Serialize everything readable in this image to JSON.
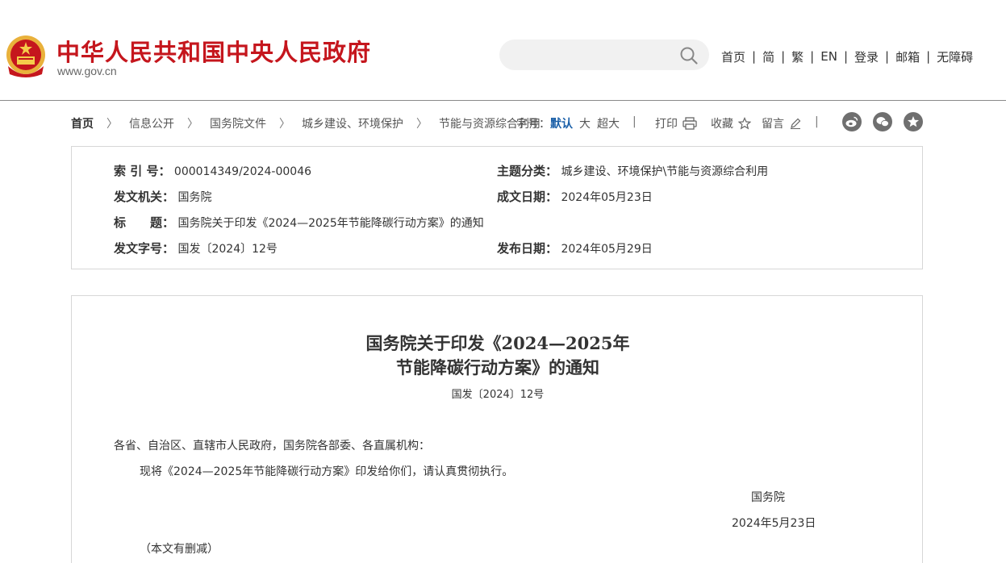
{
  "header": {
    "site_title": "中华人民共和国中央人民政府",
    "site_domain": "www.gov.cn",
    "search_placeholder": "",
    "nav": [
      "首页",
      "简",
      "繁",
      "EN",
      "登录",
      "邮箱",
      "无障碍"
    ],
    "nav_sep": "|"
  },
  "breadcrumb": {
    "home": "首页",
    "items": [
      "信息公开",
      "国务院文件",
      "城乡建设、环境保护",
      "节能与资源综合利用"
    ],
    "sep": "〉"
  },
  "toolbar": {
    "font_label": "字号：",
    "font_default": "默认",
    "font_large": "大",
    "font_xlarge": "超大",
    "print": "打印",
    "favorite": "收藏",
    "comment": "留言",
    "sep": "|"
  },
  "meta": {
    "index_label": "索 引 号：",
    "index_value": "000014349/2024-00046",
    "topic_label": "主题分类：",
    "topic_value": "城乡建设、环境保护\\节能与资源综合利用",
    "issuer_label": "发文机关：",
    "issuer_value": "国务院",
    "written_label": "成文日期：",
    "written_value": "2024年05月23日",
    "title_label": "标　　题：",
    "title_value": "国务院关于印发《2024—2025年节能降碳行动方案》的通知",
    "docno_label": "发文字号：",
    "docno_value": "国发〔2024〕12号",
    "published_label": "发布日期：",
    "published_value": "2024年05月29日"
  },
  "article": {
    "title_line1": "国务院关于印发《2024—2025年",
    "title_line2": "节能降碳行动方案》的通知",
    "doc_number": "国发〔2024〕12号",
    "salutation": "各省、自治区、直辖市人民政府，国务院各部委、各直属机构：",
    "body": "现将《2024—2025年节能降碳行动方案》印发给你们，请认真贯彻执行。",
    "signer": "国务院",
    "date": "2024年5月23日",
    "note": "（本文有删减）"
  },
  "colors": {
    "brand_red": "#c5161d",
    "link_blue": "#1a5fa8",
    "icon_gray": "#6f6f6f"
  }
}
